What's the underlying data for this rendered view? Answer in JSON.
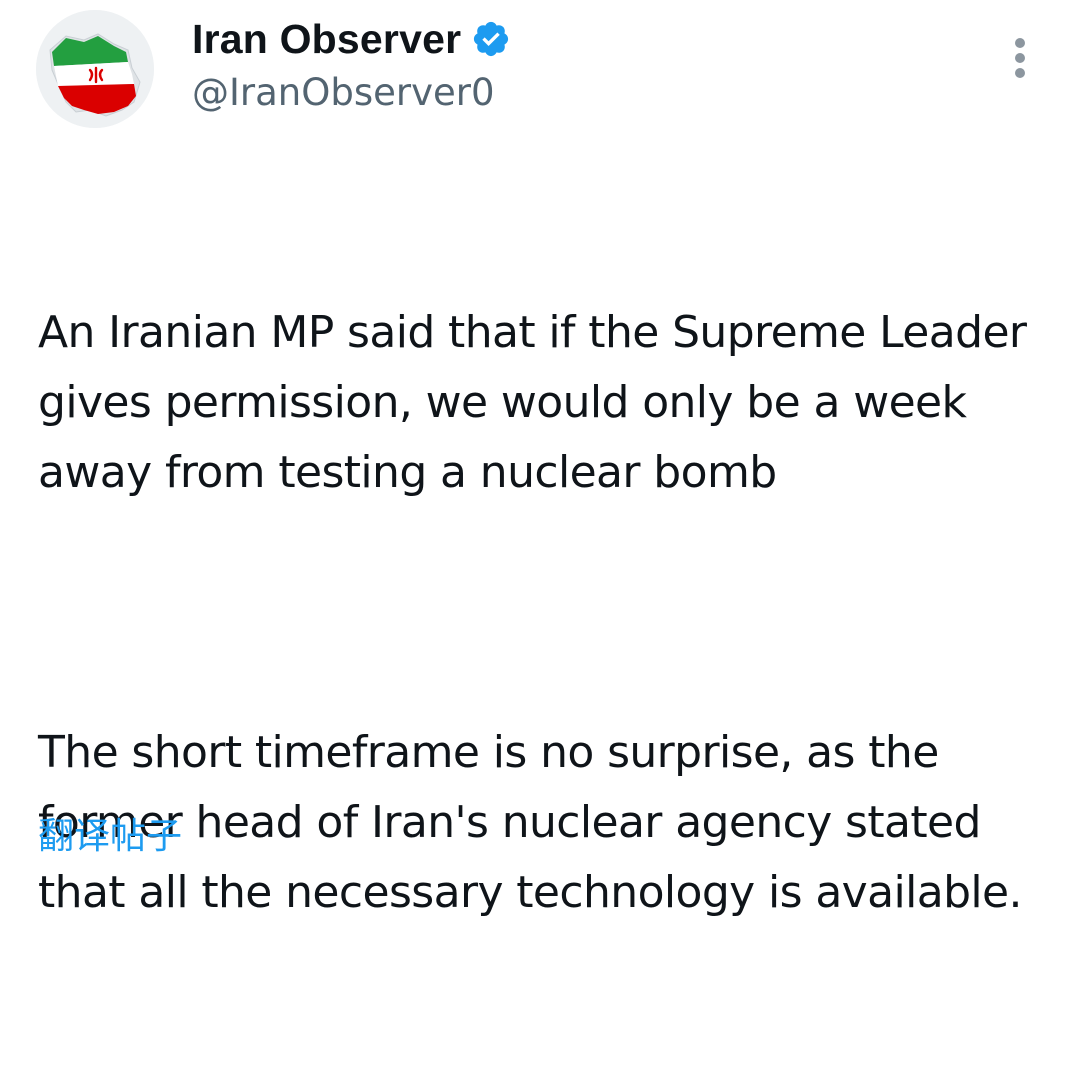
{
  "author": {
    "display_name": "Iran Observer",
    "handle": "@IranObserver0",
    "verified": true,
    "avatar_icon": "iran-map-flag-avatar"
  },
  "tweet": {
    "paragraphs": [
      "An Iranian MP said that if the Supreme Leader gives permission, we would only be a week away from testing a nuclear bomb",
      "The short timeframe is no surprise, as the former head of Iran's nuclear agency stated that all the necessary technology is available."
    ]
  },
  "actions": {
    "translate_label": "翻译帖子",
    "more_icon": "more-vertical-icon"
  },
  "colors": {
    "text": "#0f1419",
    "secondary": "#536471",
    "accent": "#1d9bf0",
    "flag_green": "#239f40",
    "flag_red": "#da0000"
  }
}
